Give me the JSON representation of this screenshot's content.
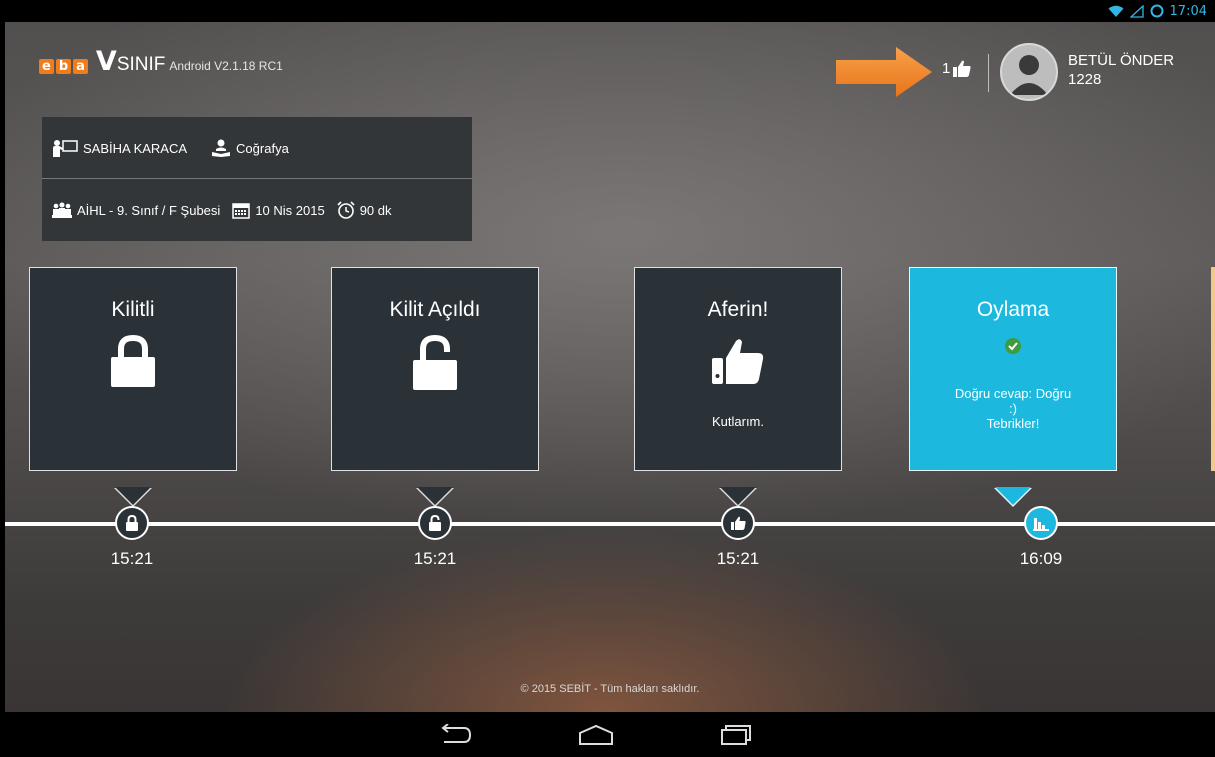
{
  "status_bar": {
    "time": "17:04",
    "icons": [
      "wifi-icon",
      "signal-icon",
      "battery-icon"
    ]
  },
  "header": {
    "logo_eba": [
      "e",
      "b",
      "a"
    ],
    "logo_v": "V",
    "logo_sinif": "SINIF",
    "version": "Android V2.1.18 RC1",
    "likes_count": "1",
    "user_name": "BETÜL ÖNDER",
    "user_id": "1228"
  },
  "class_info": {
    "teacher": "SABİHA KARACA",
    "subject": "Coğrafya",
    "class_name": "AİHL -  9. Sınıf / F Şubesi",
    "date": "10 Nis 2015",
    "duration": "90 dk"
  },
  "timeline": [
    {
      "title": "Kilitli",
      "icon": "lock-closed-icon",
      "subtitle": "",
      "time": "15:21"
    },
    {
      "title": "Kilit Açıldı",
      "icon": "lock-open-icon",
      "subtitle": "",
      "time": "15:21"
    },
    {
      "title": "Aferin!",
      "icon": "thumbs-up-icon",
      "subtitle": "Kutlarım.",
      "time": "15:21"
    },
    {
      "title": "Oylama",
      "icon": "check-circle-icon",
      "subtitle_lines": [
        "Doğru cevap: Doğru",
        ":)",
        "Tebrikler!"
      ],
      "time": "16:09",
      "node_icon": "bar-chart-icon"
    }
  ],
  "footer": {
    "copyright": "© 2015 SEBİT - Tüm hakları saklıdır."
  },
  "colors": {
    "accent": "#1db8dd",
    "card_bg": "#2a3137",
    "arrow": "#f08a24",
    "status_blue": "#33b5e5",
    "eba_orange": "#f07c1c"
  },
  "nav_bar": {
    "buttons": [
      "back-icon",
      "home-icon",
      "recents-icon"
    ]
  }
}
